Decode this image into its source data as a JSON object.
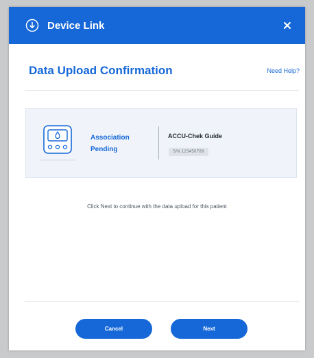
{
  "window": {
    "title": "Device Link",
    "header_icon": "download-circle-icon",
    "close_icon": "close-icon",
    "header_color": "#1668d8"
  },
  "header": {
    "title": "Data Upload Confirmation",
    "help_link": "Need Help?"
  },
  "device_card": {
    "icon": "glucose-meter-icon",
    "status": "Association Pending",
    "device_name": "ACCU-Chek Guide",
    "serial": "S/N 123456789"
  },
  "instruction": "Click Next to continue with the data upload for this patient",
  "buttons": {
    "cancel": "Cancel",
    "next": "Next"
  }
}
